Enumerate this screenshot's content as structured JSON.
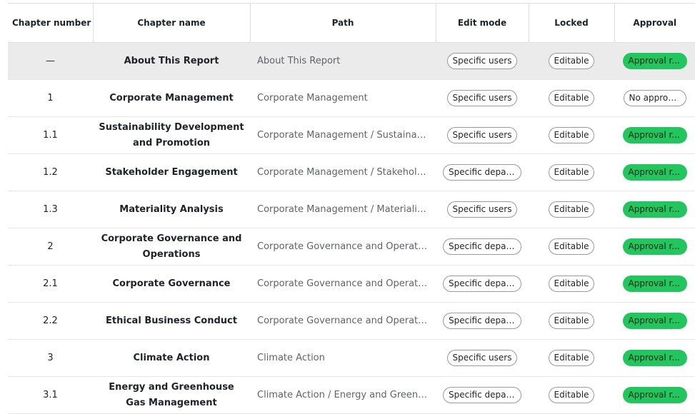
{
  "columns": {
    "chapter_number": "Chapter number",
    "chapter_name": "Chapter name",
    "path": "Path",
    "edit_mode": "Edit mode",
    "locked": "Locked",
    "approval": "Approval"
  },
  "rows": [
    {
      "number": "—",
      "name": "About This Report",
      "path": "About This Report",
      "edit_mode": "Specific users",
      "locked": "Editable",
      "approval": "Approval r...",
      "approval_on": true,
      "selected": true
    },
    {
      "number": "1",
      "name": "Corporate Management",
      "path": "Corporate Management",
      "edit_mode": "Specific users",
      "locked": "Editable",
      "approval": "No approval",
      "approval_on": false
    },
    {
      "number": "1.1",
      "name": "Sustainability Development and Promotion",
      "path": "Corporate Management / Sustainab...",
      "edit_mode": "Specific users",
      "locked": "Editable",
      "approval": "Approval r...",
      "approval_on": true
    },
    {
      "number": "1.2",
      "name": "Stakeholder Engagement",
      "path": "Corporate Management / Stakehold...",
      "edit_mode": "Specific depar...",
      "locked": "Editable",
      "approval": "Approval r...",
      "approval_on": true
    },
    {
      "number": "1.3",
      "name": "Materiality Analysis",
      "path": "Corporate Management / Materialit...",
      "edit_mode": "Specific users",
      "locked": "Editable",
      "approval": "Approval r...",
      "approval_on": true
    },
    {
      "number": "2",
      "name": "Corporate Governance and Operations",
      "path": "Corporate Governance and Operatio...",
      "edit_mode": "Specific depar...",
      "locked": "Editable",
      "approval": "Approval r...",
      "approval_on": true
    },
    {
      "number": "2.1",
      "name": "Corporate Governance",
      "path": "Corporate Governance and Operatio...",
      "edit_mode": "Specific depar...",
      "locked": "Editable",
      "approval": "Approval r...",
      "approval_on": true
    },
    {
      "number": "2.2",
      "name": "Ethical Business Conduct",
      "path": "Corporate Governance and Operatio...",
      "edit_mode": "Specific depar...",
      "locked": "Editable",
      "approval": "Approval r...",
      "approval_on": true
    },
    {
      "number": "3",
      "name": "Climate Action",
      "path": "Climate Action",
      "edit_mode": "Specific users",
      "locked": "Editable",
      "approval": "Approval r...",
      "approval_on": true
    },
    {
      "number": "3.1",
      "name": "Energy and Greenhouse Gas Management",
      "path": "Climate Action / Energy and Greenh...",
      "edit_mode": "Specific depar...",
      "locked": "Editable",
      "approval": "Approval r...",
      "approval_on": true
    }
  ],
  "colors": {
    "approval_green": "#22c55e",
    "selected_row": "#ebebeb",
    "border": "#dedede"
  }
}
